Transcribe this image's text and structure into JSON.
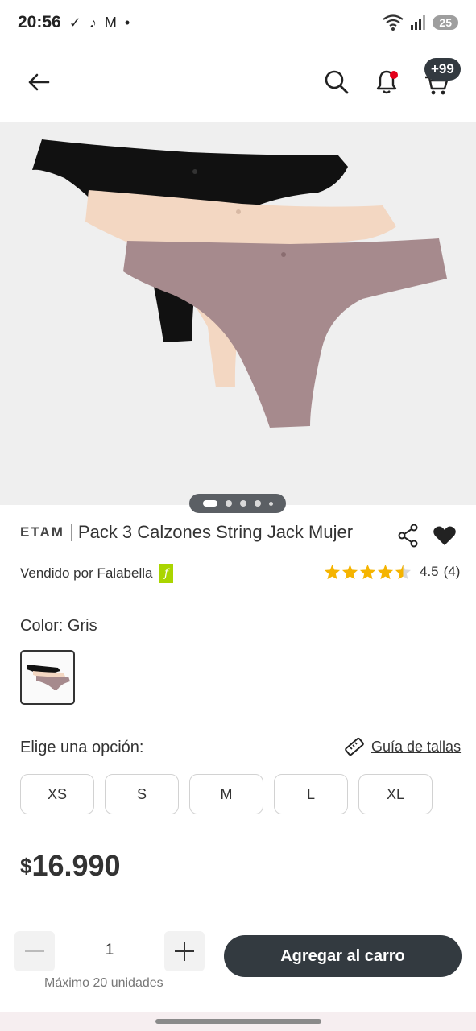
{
  "status_bar": {
    "time": "20:56",
    "battery": "25",
    "wifi_label": "6"
  },
  "header": {
    "cart_count": "+99"
  },
  "carousel": {
    "dots": 5,
    "active_index": 0
  },
  "product": {
    "brand": "ETAM",
    "name": "Pack 3 Calzones String Jack Mujer",
    "seller": "Vendido por Falabella",
    "seller_badge": "f",
    "rating_value": "4.5",
    "rating_count": "(4)",
    "rating_stars": 4.5,
    "color_label": "Color: Gris",
    "option_label": "Elige una opción:",
    "size_guide_label": "Guía de tallas",
    "sizes": [
      "XS",
      "S",
      "M",
      "L",
      "XL"
    ],
    "currency": "$",
    "price": "16.990"
  },
  "purchase": {
    "quantity": "1",
    "max_note": "Máximo 20 unidades",
    "add_to_cart_label": "Agregar al carro"
  },
  "colors": {
    "primary_dark": "#333a40",
    "star": "#f5b400",
    "falabella_green": "#aad500",
    "alert_red": "#e3001b"
  },
  "image_colors": {
    "black": "#111111",
    "nude": "#f3d7c2",
    "mauve": "#a68a8d"
  }
}
